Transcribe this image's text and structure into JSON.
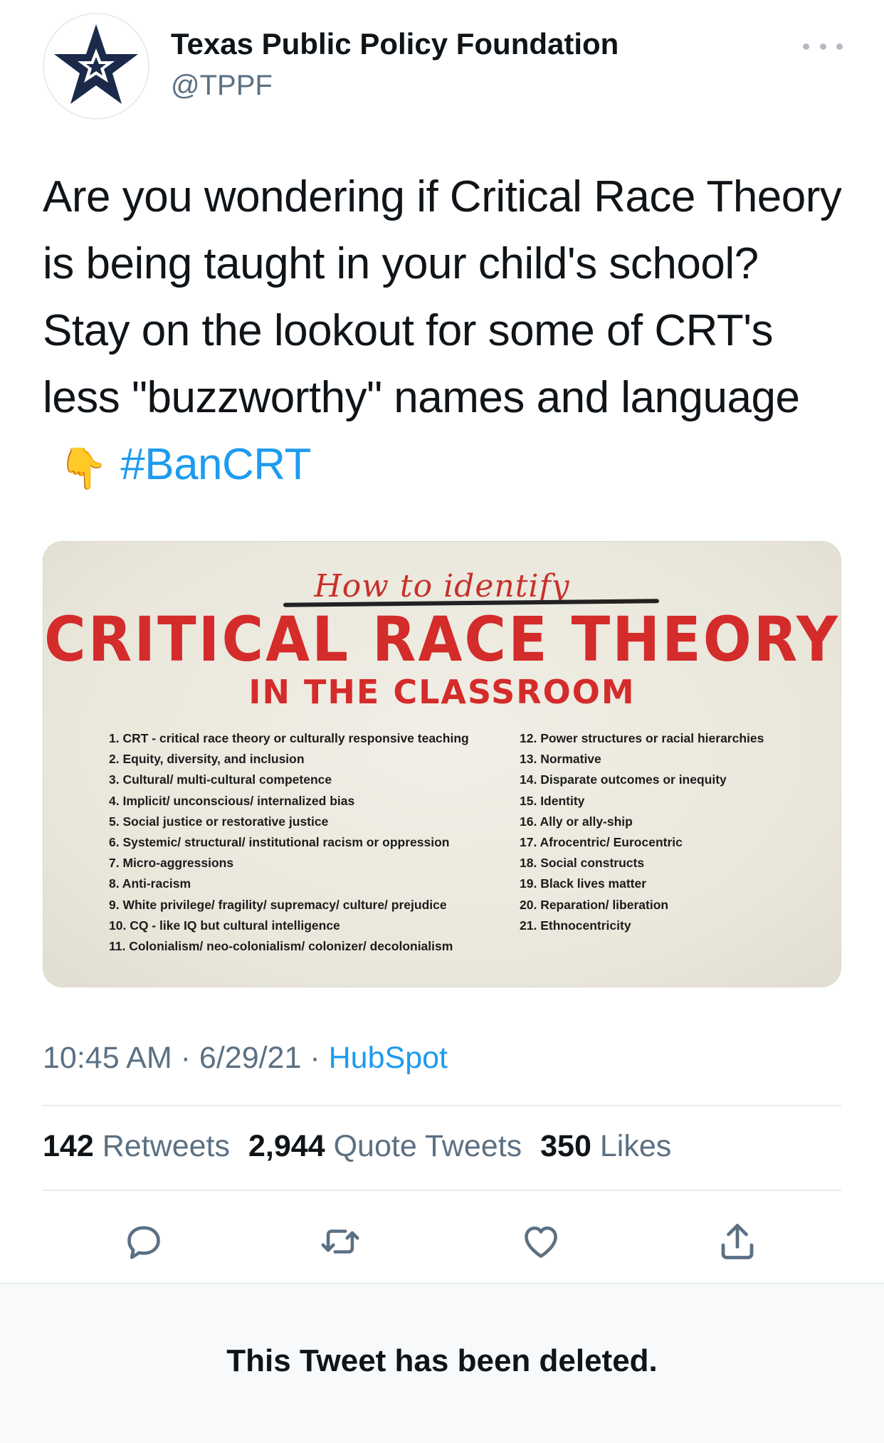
{
  "account": {
    "display_name": "Texas Public Policy Foundation",
    "handle": "@TPPF",
    "avatar_icon": "star-logo-icon"
  },
  "tweet": {
    "text_main": "Are you wondering if Critical Race Theory is being taught in your child's school? Stay on the lookout for some of CRT's less \"buzzworthy\" names and language",
    "emoji": "👇",
    "hashtag": "#BanCRT"
  },
  "media": {
    "heading_script": "How to identify",
    "heading_main": "CRITICAL RACE THEORY",
    "heading_sub": "IN THE CLASSROOM",
    "left_list": [
      "1. CRT - critical race theory or culturally responsive teaching",
      "2. Equity, diversity, and inclusion",
      "3. Cultural/ multi-cultural competence",
      "4. Implicit/ unconscious/ internalized bias",
      "5. Social justice or restorative justice",
      "6. Systemic/ structural/ institutional racism or oppression",
      "7. Micro-aggressions",
      "8. Anti-racism",
      "9. White privilege/ fragility/ supremacy/ culture/ prejudice",
      "10. CQ - like IQ but cultural intelligence",
      "11. Colonialism/ neo-colonialism/ colonizer/ decolonialism"
    ],
    "right_list": [
      "12. Power structures or racial hierarchies",
      "13. Normative",
      "14. Disparate outcomes or inequity",
      "15. Identity",
      "16. Ally or ally-ship",
      "17. Afrocentric/ Eurocentric",
      "18. Social constructs",
      "19. Black lives matter",
      "20. Reparation/ liberation",
      "21. Ethnocentricity"
    ]
  },
  "meta": {
    "time": "10:45 AM",
    "separator": "·",
    "date": "6/29/21",
    "source": "HubSpot"
  },
  "stats": {
    "retweets_count": "142",
    "retweets_label": "Retweets",
    "quotes_count": "2,944",
    "quotes_label": "Quote Tweets",
    "likes_count": "350",
    "likes_label": "Likes"
  },
  "actions": [
    "reply-icon",
    "retweet-icon",
    "like-icon",
    "share-icon"
  ],
  "deleted_notice": "This Tweet has been deleted.",
  "colors": {
    "link": "#1d9bf0",
    "secondary_text": "#5b7083",
    "infographic_red": "#d42b2b",
    "star_navy": "#1b2a4a"
  }
}
